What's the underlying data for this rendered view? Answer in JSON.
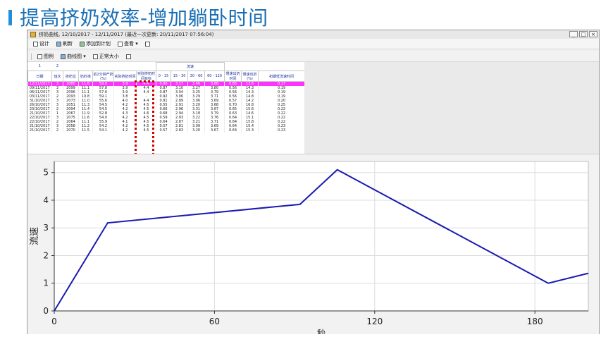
{
  "slide": {
    "title": "提高挤奶效率-增加躺卧时间"
  },
  "window": {
    "title": "挤奶曲线, 12/10/2017 - 12/11/2017 (最近一次更新: 20/11/2017 07:56:04)",
    "controls": [
      "_",
      "□",
      "×"
    ]
  },
  "toolbar1": {
    "items": [
      "设计",
      "刷新",
      "添加到计划",
      "查看 ▾",
      ""
    ]
  },
  "toolbar2": {
    "items": [
      "图例",
      "曲线图 ▾",
      "正常大小",
      ""
    ]
  },
  "table": {
    "filter_marks": [
      "1",
      "2"
    ],
    "headers": [
      "日期",
      "班次",
      "挤奶位",
      "奶料率",
      "前2分钟产奶(%)",
      "实际挤奶时间",
      "实际挤奶时间目标"
    ],
    "flow_group": "流速",
    "flow_headers": [
      "0 - 15",
      "15 - 30",
      "30 - 60",
      "60 - 120"
    ],
    "tail_headers": [
      "慢速出奶时间",
      "慢速出奶(%)",
      "初期低流速时间"
    ],
    "rows": [
      [
        "12/11/2017",
        "3",
        "2080",
        "11.6",
        "59.0",
        "3.9",
        "4.4",
        "0.90",
        "3.17",
        "3.46",
        "3.86",
        "0.65",
        "13.6",
        "0.17"
      ],
      [
        "09/11/2017",
        "3",
        "2099",
        "11.1",
        "57.8",
        "3.9",
        "4.4",
        "0.87",
        "3.10",
        "3.27",
        "3.80",
        "0.56",
        "14.3",
        "0.19"
      ],
      [
        "06/11/2017",
        "3",
        "2096",
        "11.1",
        "57.6",
        "3.9",
        "4.4",
        "0.87",
        "3.04",
        "3.25",
        "3.79",
        "0.56",
        "14.3",
        "0.19"
      ],
      [
        "03/11/2017",
        "2",
        "2093",
        "10.8",
        "59.1",
        "3.8",
        "-",
        "0.92",
        "3.06",
        "3.29",
        "3.71",
        "0.56",
        "14.8",
        "0.19"
      ],
      [
        "31/10/2017",
        "3",
        "2073",
        "11.0",
        "55.6",
        "4.0",
        "4.4",
        "0.81",
        "2.89",
        "3.06",
        "3.69",
        "0.57",
        "14.2",
        "0.20"
      ],
      [
        "26/10/2017",
        "3",
        "2051",
        "11.3",
        "54.5",
        "4.2",
        "4.5",
        "0.55",
        "2.91",
        "3.20",
        "3.68",
        "0.70",
        "16.8",
        "0.25"
      ],
      [
        "23/10/2017",
        "2",
        "2094",
        "11.4",
        "54.5",
        "4.2",
        "4.5",
        "0.66",
        "2.96",
        "3.31",
        "3.67",
        "0.65",
        "15.6",
        "0.22"
      ],
      [
        "21/10/2017",
        "1",
        "2067",
        "11.9",
        "52.8",
        "4.3",
        "4.6",
        "0.68",
        "2.94",
        "3.18",
        "3.79",
        "0.63",
        "14.6",
        "0.22"
      ],
      [
        "22/10/2017",
        "3",
        "2075",
        "11.6",
        "54.0",
        "4.2",
        "4.5",
        "0.59",
        "2.93",
        "3.22",
        "3.76",
        "0.64",
        "15.1",
        "0.22"
      ],
      [
        "22/10/2017",
        "2",
        "2064",
        "11.1",
        "55.9",
        "4.1",
        "4.5",
        "0.64",
        "2.87",
        "3.21",
        "3.71",
        "0.64",
        "15.8",
        "0.22"
      ],
      [
        "21/10/2017",
        "3",
        "2058",
        "11.2",
        "54.2",
        "4.2",
        "4.5",
        "0.57",
        "2.81",
        "3.09",
        "3.69",
        "0.64",
        "15.4",
        "0.23"
      ],
      [
        "21/10/2017",
        "2",
        "2070",
        "11.5",
        "54.1",
        "4.2",
        "4.5",
        "0.57",
        "2.83",
        "3.20",
        "3.67",
        "0.64",
        "15.3",
        "0.23"
      ]
    ]
  },
  "chart_data": {
    "type": "line",
    "title": "",
    "xlabel": "秒",
    "ylabel": "流速",
    "x": [
      0,
      20,
      92,
      106,
      185,
      200
    ],
    "series": [
      {
        "values": [
          0,
          3.18,
          3.85,
          5.1,
          1.0,
          1.36
        ]
      }
    ],
    "xlim": [
      0,
      200
    ],
    "ylim": [
      0,
      5.4
    ],
    "xticks": [
      0,
      60,
      120,
      180
    ],
    "yticks": [
      0,
      1,
      2,
      3,
      4,
      5
    ],
    "grid": true,
    "line_color": "#1a1ab0"
  }
}
